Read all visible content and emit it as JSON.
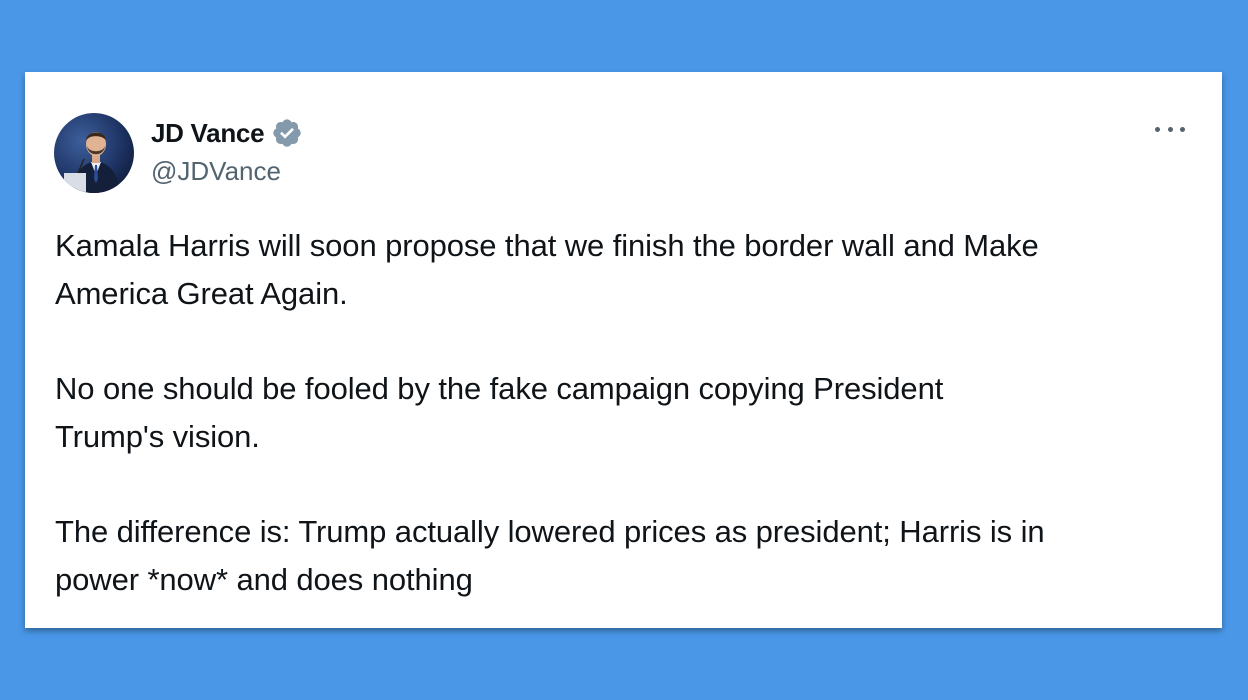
{
  "tweet": {
    "author": {
      "display_name": "JD Vance",
      "handle": "@JDVance",
      "verified": true,
      "verified_badge_color": "#829AAB"
    },
    "more_options_icon": "more-horizontal-icon",
    "paragraphs": [
      "Kamala Harris will soon propose that we finish the border wall and Make\nAmerica Great Again.",
      "No one should be fooled by the fake campaign copying President\nTrump's vision.",
      "The difference is: Trump actually lowered prices as president; Harris is in\npower *now* and does nothing"
    ]
  },
  "colors": {
    "background": "#4A97E8",
    "card": "#FFFFFF",
    "text_primary": "#0F1419",
    "text_secondary": "#536471"
  }
}
